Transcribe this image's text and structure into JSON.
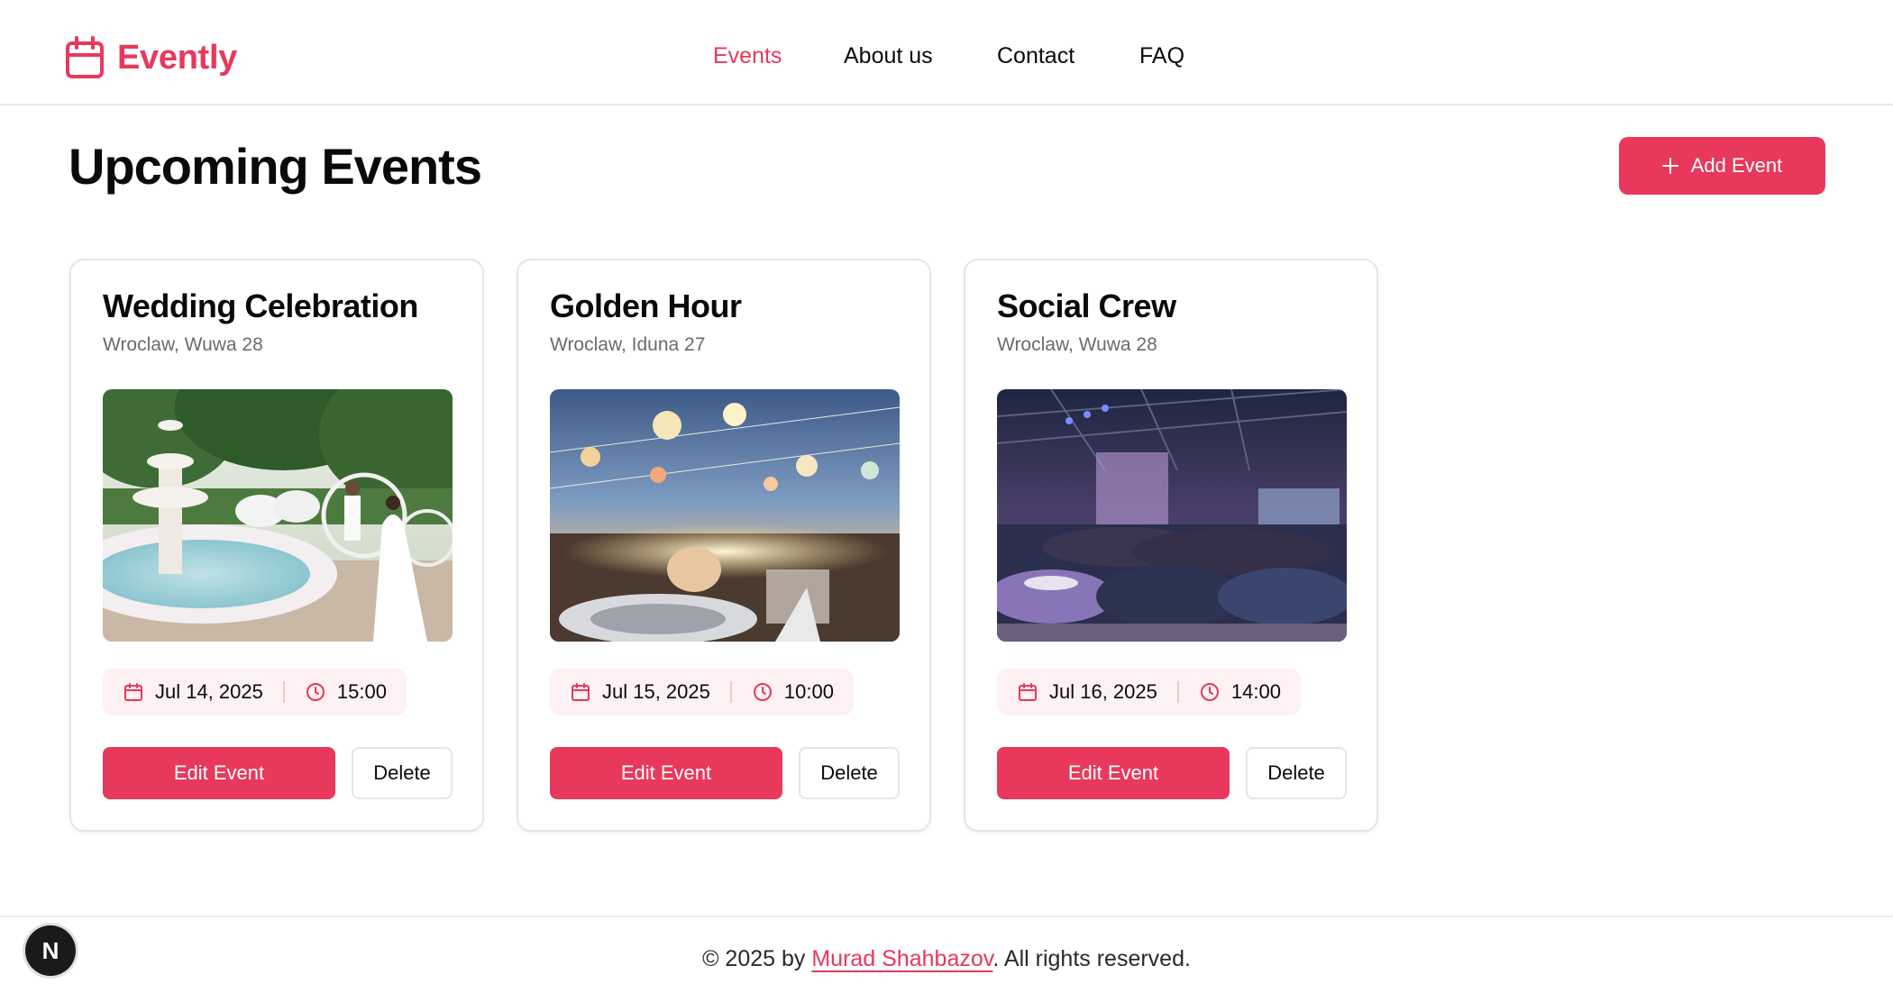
{
  "brand": {
    "name": "Evently",
    "color": "#e8385b"
  },
  "nav": [
    {
      "label": "Events",
      "active": true
    },
    {
      "label": "About us",
      "active": false
    },
    {
      "label": "Contact",
      "active": false
    },
    {
      "label": "FAQ",
      "active": false
    }
  ],
  "page": {
    "title": "Upcoming Events",
    "add_button": "Add Event"
  },
  "events": [
    {
      "title": "Wedding Celebration",
      "address": "Wroclaw, Wuwa 28",
      "date": "Jul 14, 2025",
      "time": "15:00",
      "edit_label": "Edit Event",
      "delete_label": "Delete"
    },
    {
      "title": "Golden Hour",
      "address": "Wroclaw, Iduna 27",
      "date": "Jul 15, 2025",
      "time": "10:00",
      "edit_label": "Edit Event",
      "delete_label": "Delete"
    },
    {
      "title": "Social Crew",
      "address": "Wroclaw, Wuwa 28",
      "date": "Jul 16, 2025",
      "time": "14:00",
      "edit_label": "Edit Event",
      "delete_label": "Delete"
    }
  ],
  "footer": {
    "prefix": "© 2025 by ",
    "author": "Murad Shahbazov",
    "suffix": ". All rights reserved."
  },
  "dev_badge": {
    "letter": "N"
  }
}
